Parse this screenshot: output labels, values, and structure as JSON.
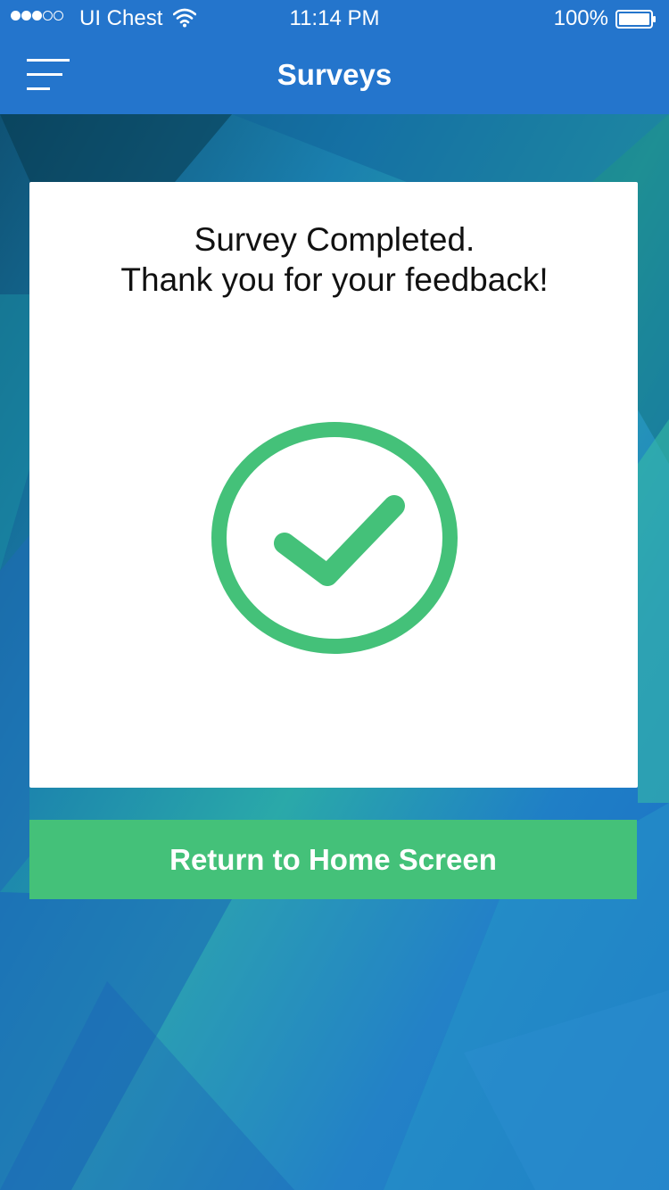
{
  "status_bar": {
    "signal_strength": "3 of 5",
    "carrier": "UI Chest",
    "time": "11:14 PM",
    "battery_percent": "100%"
  },
  "nav": {
    "menu_icon": "hamburger-menu-icon",
    "title": "Surveys"
  },
  "card": {
    "line1": "Survey Completed.",
    "line2": "Thank you for your feedback!",
    "icon": "check-circle-icon"
  },
  "actions": {
    "return_label": "Return to Home Screen"
  },
  "colors": {
    "header": "#2475cc",
    "accent_green": "#44c179",
    "background_blue": "#1d6fc4",
    "background_teal": "#2fb7a3",
    "card": "#ffffff"
  }
}
